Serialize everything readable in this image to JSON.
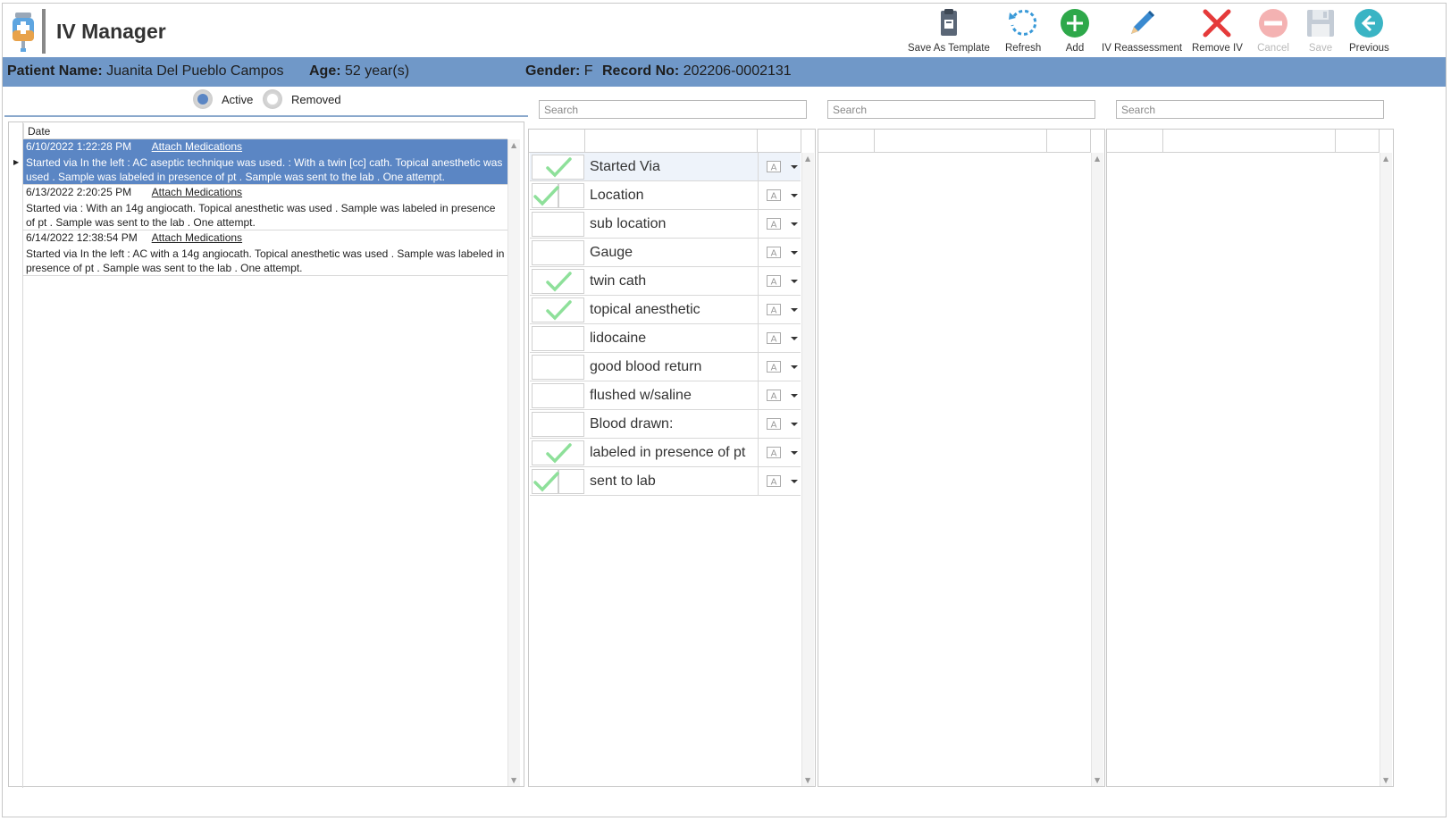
{
  "app": {
    "title": "IV Manager"
  },
  "toolbar": {
    "buttons": [
      {
        "label": "Save As Template",
        "icon": "clipboard-icon",
        "enabled": true
      },
      {
        "label": "Refresh",
        "icon": "refresh-icon",
        "enabled": true
      },
      {
        "label": "Add",
        "icon": "add-icon",
        "enabled": true
      },
      {
        "label": "IV Reassessment",
        "icon": "pencil-icon",
        "enabled": true
      },
      {
        "label": "Remove IV",
        "icon": "red-x-icon",
        "enabled": true
      },
      {
        "label": "Cancel",
        "icon": "cancel-icon",
        "enabled": false
      },
      {
        "label": "Save",
        "icon": "floppy-icon",
        "enabled": false
      },
      {
        "label": "Previous",
        "icon": "back-arrow-icon",
        "enabled": true
      }
    ]
  },
  "patient": {
    "name_label": "Patient Name:",
    "name": "Juanita Del Pueblo Campos",
    "age_label": "Age:",
    "age": "52 year(s)",
    "gender_label": "Gender:",
    "gender": "F",
    "record_label": "Record No:",
    "record": "202206-0002131"
  },
  "filter": {
    "active_label": "Active",
    "removed_label": "Removed",
    "selected": "Active"
  },
  "iv_list": {
    "column_header": "Date",
    "rows": [
      {
        "date": "6/10/2022 1:22:28 PM",
        "link": "Attach Medications",
        "description": "Started via In the left : AC aseptic technique was used. : With a twin [cc] cath. Topical anesthetic was used . Sample was labeled in presence of pt . Sample was sent to the lab . One attempt.",
        "selected": true
      },
      {
        "date": "6/13/2022 2:20:25 PM",
        "link": "Attach Medications",
        "description": "Started via : With an 14g angiocath. Topical anesthetic was used . Sample was labeled in presence of pt . Sample was sent to the lab . One attempt.",
        "selected": false
      },
      {
        "date": "6/14/2022 12:38:54 PM",
        "link": "Attach Medications",
        "description": "Started via In the left : AC with a 14g angiocath. Topical anesthetic was used . Sample was labeled in presence of pt . Sample was sent to the lab . One attempt.",
        "selected": false
      }
    ]
  },
  "search": {
    "placeholder_1": "Search",
    "placeholder_2": "Search",
    "placeholder_3": "Search"
  },
  "options": {
    "items": [
      {
        "label": "Started Via",
        "checked": true
      },
      {
        "label": "Location",
        "checked": true
      },
      {
        "label": "sub location",
        "checked": false
      },
      {
        "label": "Gauge",
        "checked": false
      },
      {
        "label": "twin cath",
        "checked": true
      },
      {
        "label": "topical anesthetic",
        "checked": true
      },
      {
        "label": "lidocaine",
        "checked": false
      },
      {
        "label": "good blood return",
        "checked": false
      },
      {
        "label": "flushed w/saline",
        "checked": false
      },
      {
        "label": "Blood drawn:",
        "checked": false
      },
      {
        "label": "labeled in presence of pt",
        "checked": true
      },
      {
        "label": "sent to lab",
        "checked": true
      }
    ]
  },
  "colors": {
    "header_bar": "#7098c8",
    "selection": "#5b86c4",
    "check_green": "#8ee09a"
  }
}
